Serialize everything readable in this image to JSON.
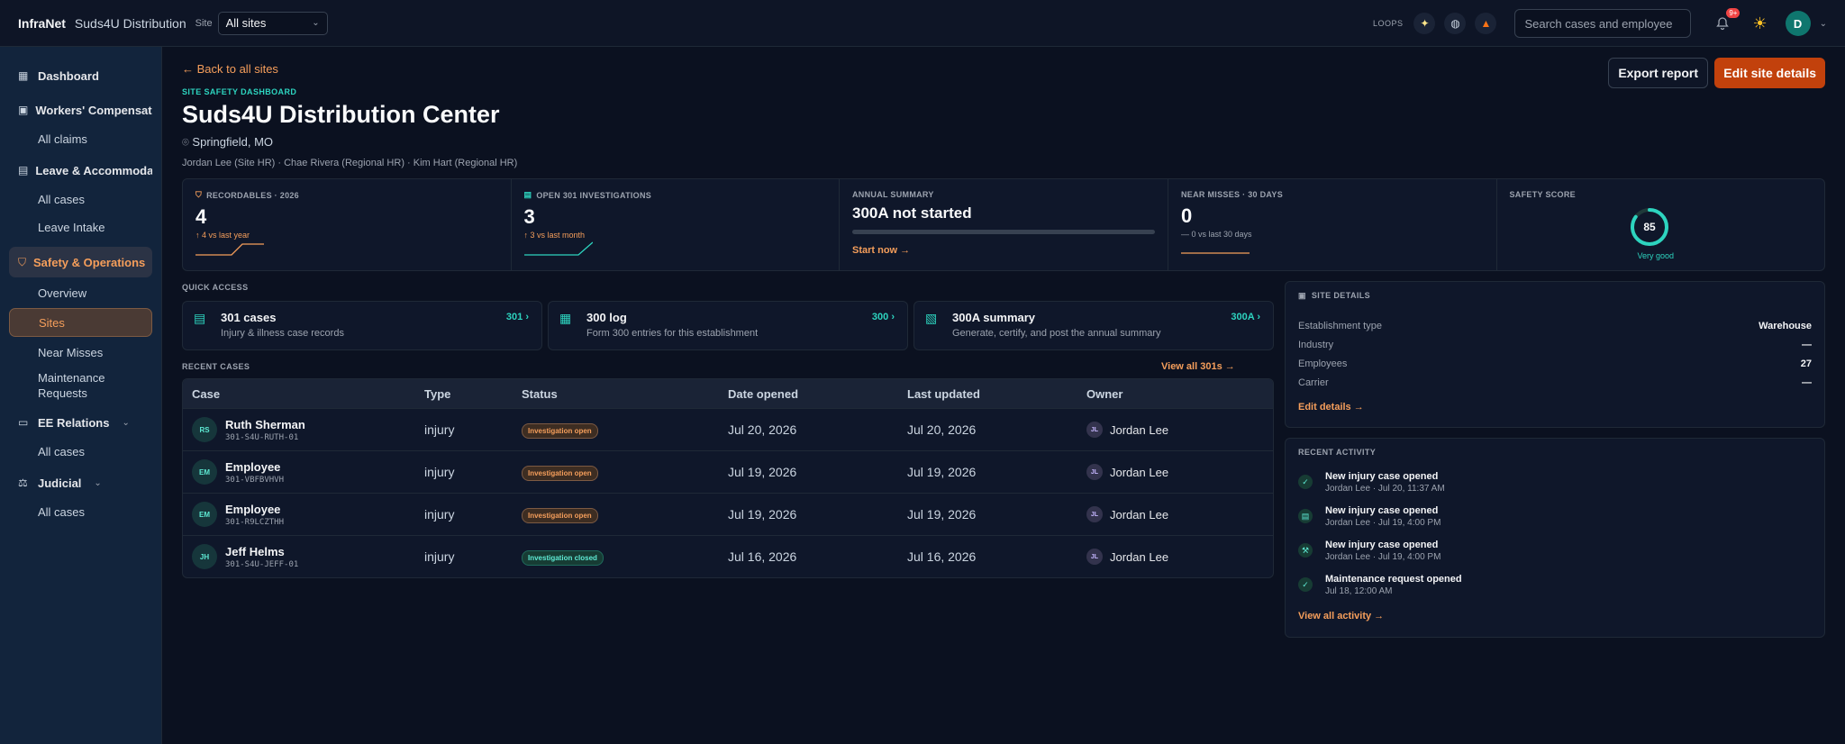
{
  "topbar": {
    "brand": "InfraNet",
    "brand_site": "Suds4U Distribution",
    "site_label": "Site",
    "site_value": "All sites",
    "loops_label": "LOOPS",
    "search_placeholder": "Search cases and employee",
    "notif_count": "9+",
    "avatar": "D"
  },
  "sidebar": {
    "dashboard": "Dashboard",
    "workers_comp": "Workers' Compensation",
    "all_claims": "All claims",
    "leave": "Leave & Accommodations",
    "leave_all": "All cases",
    "leave_intake": "Leave Intake",
    "safety": "Safety & Operations",
    "overview": "Overview",
    "sites": "Sites",
    "near_misses": "Near Misses",
    "maintenance": "Maintenance Requests",
    "ee_relations": "EE Relations",
    "ee_all": "All cases",
    "judicial": "Judicial",
    "judicial_all": "All cases"
  },
  "header": {
    "back": "← Back to all sites",
    "eyebrow": "SITE SAFETY DASHBOARD",
    "title": "Suds4U Distribution Center",
    "location": "Springfield, MO",
    "people": "Jordan Lee (Site HR) · Chae Rivera (Regional HR) · Kim Hart (Regional HR)",
    "export": "Export report",
    "edit": "Edit site details"
  },
  "kpis": {
    "recordables": {
      "label": "RECORDABLES · 2026",
      "value": "4",
      "trend": "↑ 4 vs last year"
    },
    "open301": {
      "label": "OPEN 301 INVESTIGATIONS",
      "value": "3",
      "trend": "↑ 3 vs last month"
    },
    "annual": {
      "label": "ANNUAL SUMMARY",
      "value": "300A not started",
      "link": "Start now →",
      "progress": 0
    },
    "near": {
      "label": "NEAR MISSES · 30 DAYS",
      "value": "0",
      "trend": "— 0 vs last 30 days"
    },
    "score": {
      "label": "SAFETY SCORE",
      "value": "85",
      "caption": "Very good",
      "fraction": 0.85
    }
  },
  "quick_access": {
    "label": "QUICK ACCESS",
    "items": [
      {
        "title": "301 cases",
        "sub": "Injury & illness case records",
        "link": "301 ›"
      },
      {
        "title": "300 log",
        "sub": "Form 300 entries for this establishment",
        "link": "300 ›"
      },
      {
        "title": "300A summary",
        "sub": "Generate, certify, and post the annual summary",
        "link": "300A ›"
      }
    ]
  },
  "recent_cases": {
    "label": "RECENT CASES",
    "view_all": "View all 301s →",
    "headers": [
      "Case",
      "Type",
      "Status",
      "Date opened",
      "Last updated",
      "Owner"
    ],
    "rows": [
      {
        "initials": "RS",
        "name": "Ruth Sherman",
        "id": "301-S4U-RUTH-01",
        "type": "injury",
        "status": "Investigation open",
        "opened": "Jul 20, 2026",
        "updated": "Jul 20, 2026",
        "owner_initials": "JL",
        "owner": "Jordan Lee"
      },
      {
        "initials": "EM",
        "name": "Employee",
        "id": "301-VBFBVHVH",
        "type": "injury",
        "status": "Investigation open",
        "opened": "Jul 19, 2026",
        "updated": "Jul 19, 2026",
        "owner_initials": "JL",
        "owner": "Jordan Lee"
      },
      {
        "initials": "EM",
        "name": "Employee",
        "id": "301-R9LCZTHH",
        "type": "injury",
        "status": "Investigation open",
        "opened": "Jul 19, 2026",
        "updated": "Jul 19, 2026",
        "owner_initials": "JL",
        "owner": "Jordan Lee"
      },
      {
        "initials": "JH",
        "name": "Jeff Helms",
        "id": "301-S4U-JEFF-01",
        "type": "injury",
        "status": "Investigation closed",
        "opened": "Jul 16, 2026",
        "updated": "Jul 16, 2026",
        "owner_initials": "JL",
        "owner": "Jordan Lee"
      }
    ]
  },
  "site_details": {
    "label": "SITE DETAILS",
    "rows": [
      {
        "k": "Establishment type",
        "v": "Warehouse"
      },
      {
        "k": "Industry",
        "v": "—"
      },
      {
        "k": "Employees",
        "v": "27"
      },
      {
        "k": "Carrier",
        "v": "—"
      }
    ],
    "edit": "Edit details →"
  },
  "activity": {
    "label": "RECENT ACTIVITY",
    "items": [
      {
        "title": "New injury case opened",
        "sub": "Jordan Lee · Jul 20, 11:37 AM",
        "icon": "check-circle-icon"
      },
      {
        "title": "New injury case opened",
        "sub": "Jordan Lee · Jul 19, 4:00 PM",
        "icon": "clipboard-icon"
      },
      {
        "title": "New injury case opened",
        "sub": "Jordan Lee · Jul 19, 4:00 PM",
        "icon": "wrench-icon"
      },
      {
        "title": "Maintenance request opened",
        "sub": "Jul 18, 12:00 AM",
        "icon": "check-circle-icon"
      }
    ],
    "view_all": "View all activity →"
  },
  "colors": {
    "accent": "#f59e5b",
    "teal": "#2dd4bf",
    "primary_button": "#c2410c"
  }
}
